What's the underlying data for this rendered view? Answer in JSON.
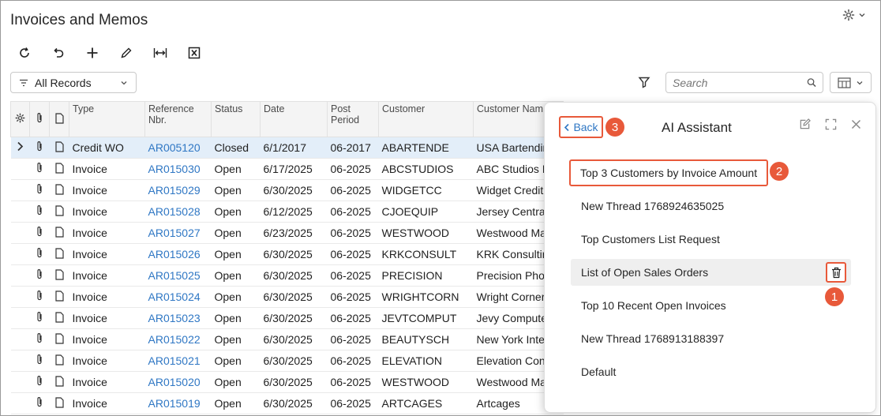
{
  "page": {
    "title": "Invoices and Memos"
  },
  "toolbar": {
    "buttons": [
      "refresh-icon",
      "undo-icon",
      "add-icon",
      "edit-icon",
      "fit-columns-icon",
      "excel-export-icon"
    ]
  },
  "filter": {
    "selected": "All Records"
  },
  "search": {
    "placeholder": "Search"
  },
  "grid": {
    "columns": [
      "Type",
      "Reference Nbr.",
      "Status",
      "Date",
      "Post Period",
      "Customer",
      "Customer Nam"
    ],
    "rows": [
      {
        "type": "Credit WO",
        "ref": "AR005120",
        "status": "Closed",
        "date": "6/1/2017",
        "period": "06-2017",
        "customer": "ABARTENDE",
        "name": "USA Bartendin"
      },
      {
        "type": "Invoice",
        "ref": "AR015030",
        "status": "Open",
        "date": "6/17/2025",
        "period": "06-2025",
        "customer": "ABCSTUDIOS",
        "name": "ABC Studios I"
      },
      {
        "type": "Invoice",
        "ref": "AR015029",
        "status": "Open",
        "date": "6/30/2025",
        "period": "06-2025",
        "customer": "WIDGETCC",
        "name": "Widget Credit"
      },
      {
        "type": "Invoice",
        "ref": "AR015028",
        "status": "Open",
        "date": "6/12/2025",
        "period": "06-2025",
        "customer": "CJOEQUIP",
        "name": "Jersey Centra"
      },
      {
        "type": "Invoice",
        "ref": "AR015027",
        "status": "Open",
        "date": "6/23/2025",
        "period": "06-2025",
        "customer": "WESTWOOD",
        "name": "Westwood Ma"
      },
      {
        "type": "Invoice",
        "ref": "AR015026",
        "status": "Open",
        "date": "6/30/2025",
        "period": "06-2025",
        "customer": "KRKCONSULT",
        "name": "KRK Consultin"
      },
      {
        "type": "Invoice",
        "ref": "AR015025",
        "status": "Open",
        "date": "6/30/2025",
        "period": "06-2025",
        "customer": "PRECISION",
        "name": "Precision Pho"
      },
      {
        "type": "Invoice",
        "ref": "AR015024",
        "status": "Open",
        "date": "6/30/2025",
        "period": "06-2025",
        "customer": "WRIGHTCORN",
        "name": "Wright Corner"
      },
      {
        "type": "Invoice",
        "ref": "AR015023",
        "status": "Open",
        "date": "6/30/2025",
        "period": "06-2025",
        "customer": "JEVTCOMPUT",
        "name": "Jevy Compute"
      },
      {
        "type": "Invoice",
        "ref": "AR015022",
        "status": "Open",
        "date": "6/30/2025",
        "period": "06-2025",
        "customer": "BEAUTYSCH",
        "name": "New York Inte"
      },
      {
        "type": "Invoice",
        "ref": "AR015021",
        "status": "Open",
        "date": "6/30/2025",
        "period": "06-2025",
        "customer": "ELEVATION",
        "name": "Elevation Con"
      },
      {
        "type": "Invoice",
        "ref": "AR015020",
        "status": "Open",
        "date": "6/30/2025",
        "period": "06-2025",
        "customer": "WESTWOOD",
        "name": "Westwood Ma"
      },
      {
        "type": "Invoice",
        "ref": "AR015019",
        "status": "Open",
        "date": "6/30/2025",
        "period": "06-2025",
        "customer": "ARTCAGES",
        "name": "Artcages"
      }
    ]
  },
  "assistant": {
    "title": "AI Assistant",
    "back_label": "Back",
    "threads": [
      "Top 3 Customers by Invoice Amount",
      "New Thread 1768924635025",
      "Top Customers List Request",
      "List of Open Sales Orders",
      "Top 10 Recent Open Invoices",
      "New Thread 1768913188397",
      "Default"
    ],
    "badges": {
      "one": "1",
      "two": "2",
      "three": "3"
    }
  },
  "colors": {
    "accent": "#2f77c4",
    "callout": "#e8593a",
    "selected_row": "#e3eef9"
  }
}
